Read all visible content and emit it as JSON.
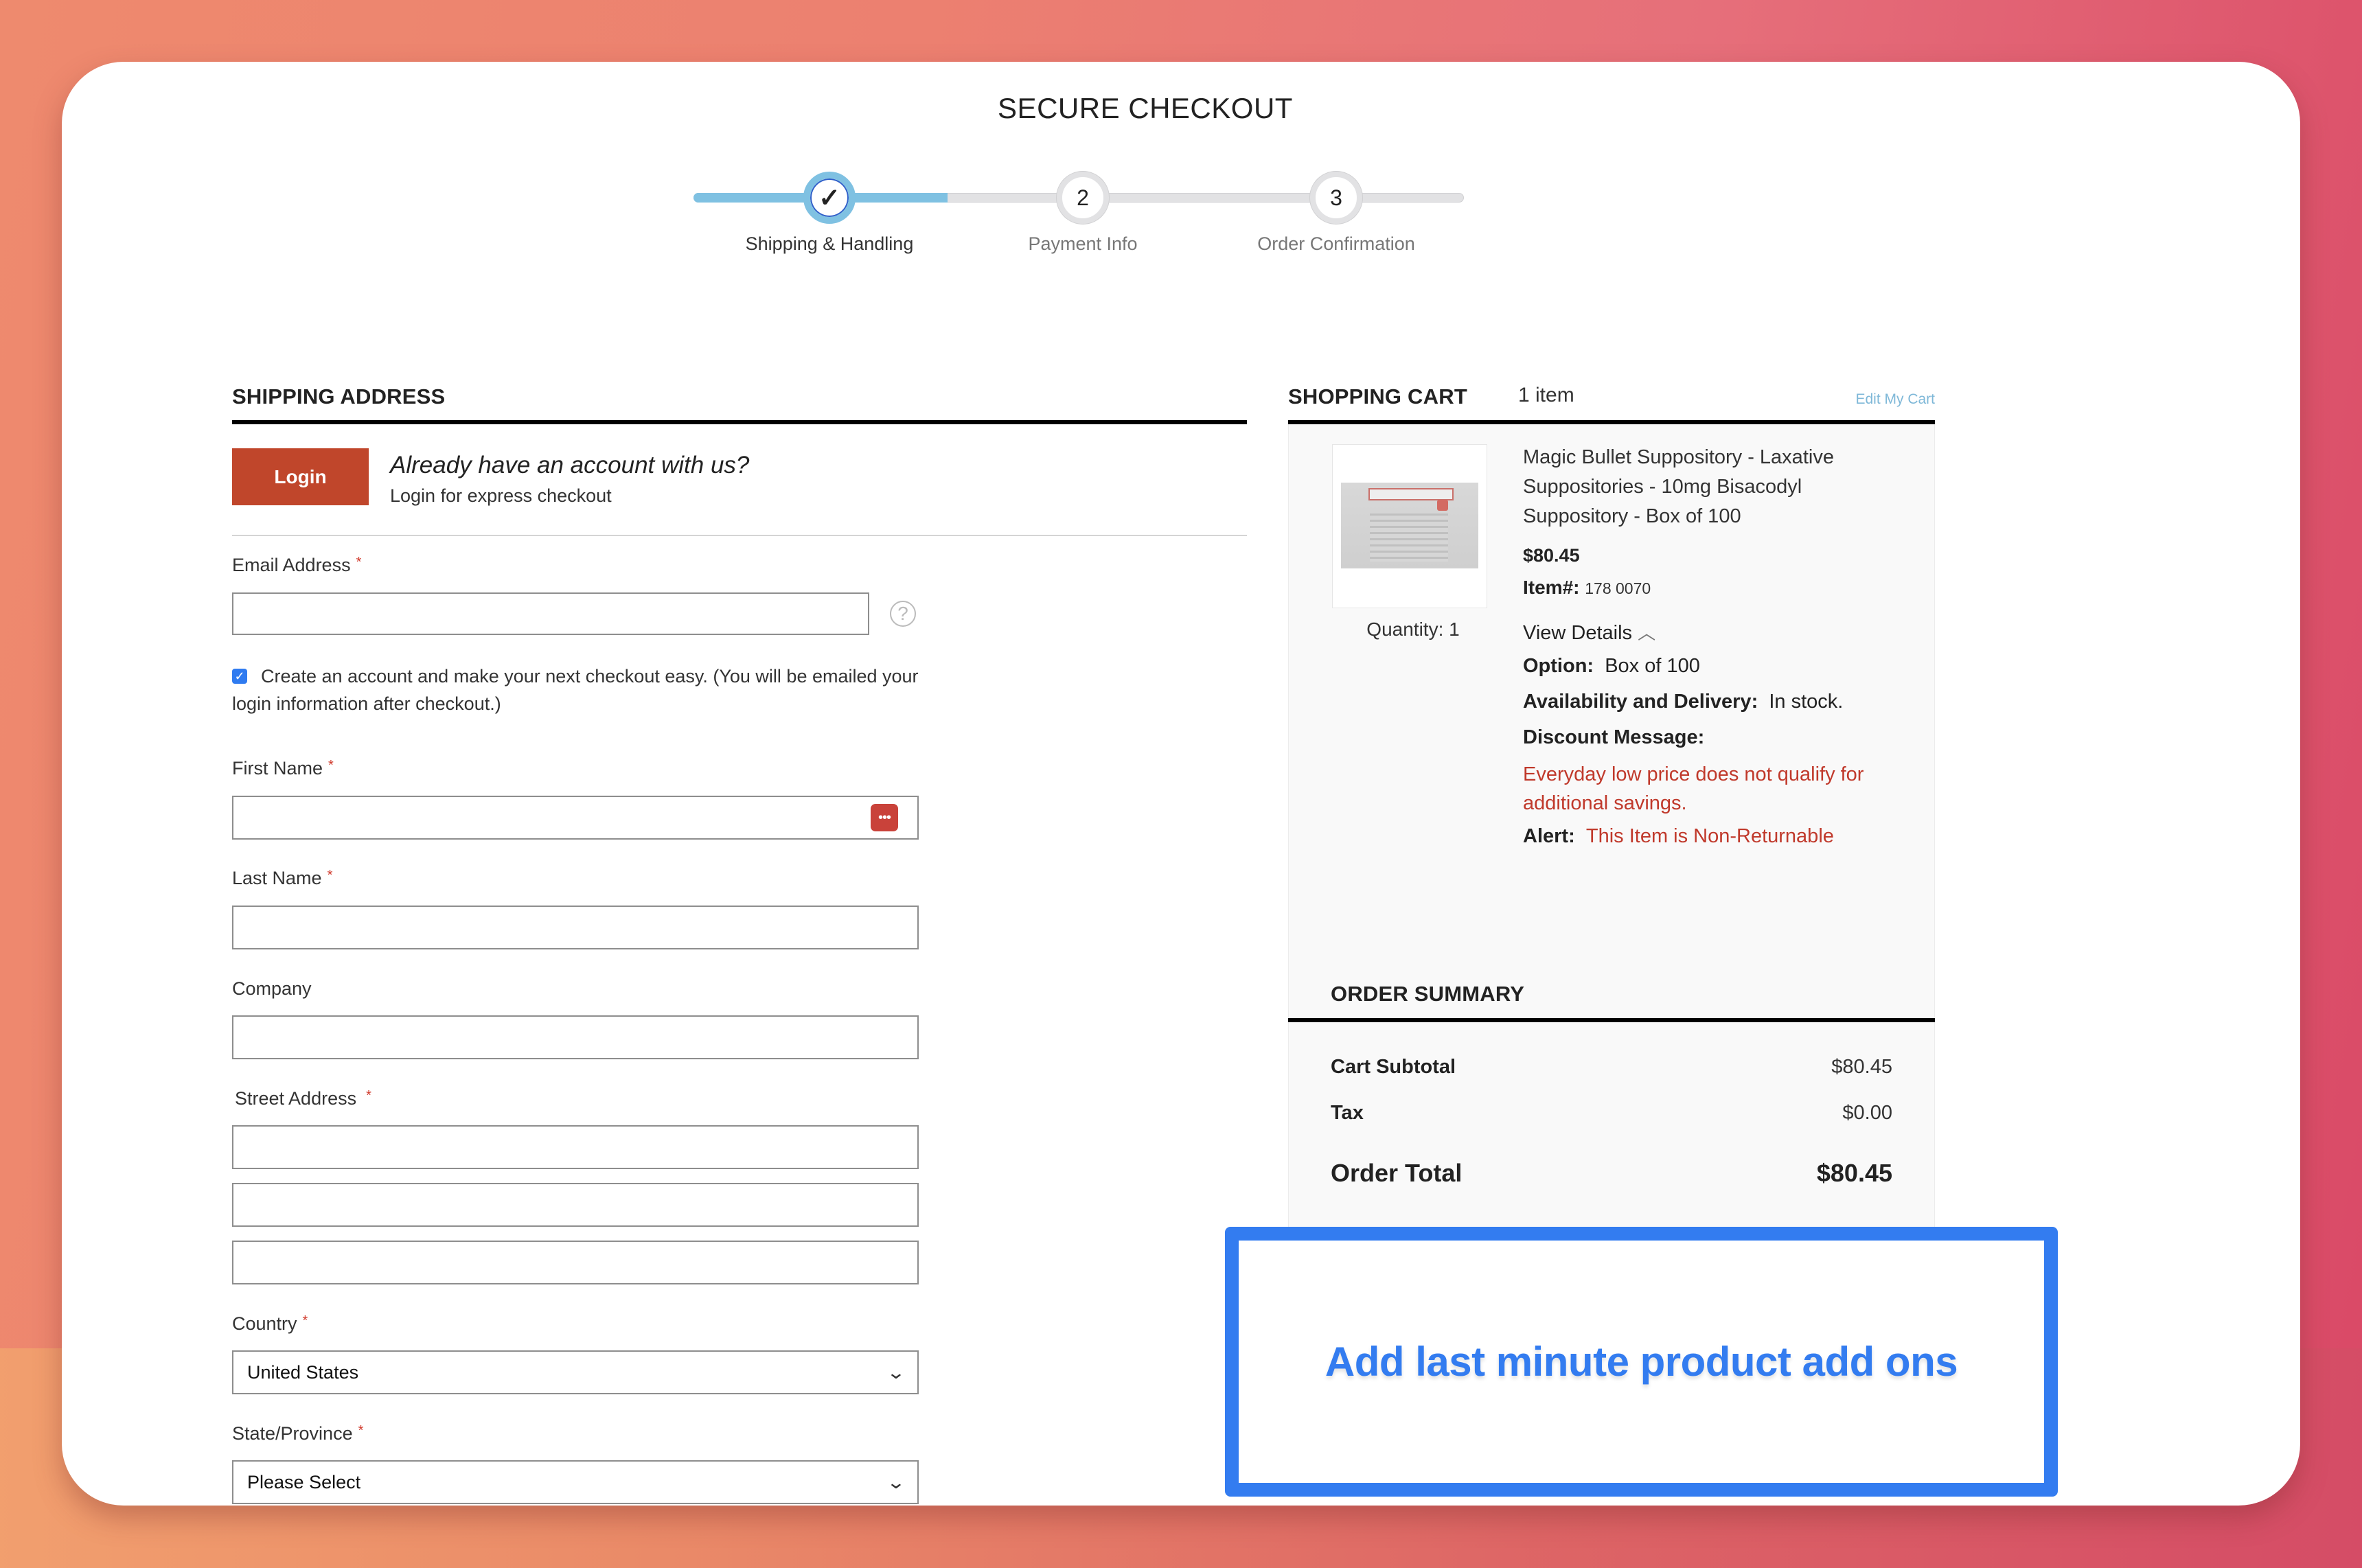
{
  "page": {
    "title": "SECURE CHECKOUT"
  },
  "stepper": {
    "progress_percent": 33,
    "steps": [
      {
        "number": "✓",
        "label": "Shipping & Handling",
        "state": "done"
      },
      {
        "number": "2",
        "label": "Payment Info",
        "state": "todo"
      },
      {
        "number": "3",
        "label": "Order Confirmation",
        "state": "todo"
      }
    ]
  },
  "shipping": {
    "heading": "SHIPPING ADDRESS",
    "login_button": "Login",
    "account_question": "Already have an account with us?",
    "account_sub": "Login for express checkout",
    "required_mark": "*",
    "email": {
      "label": "Email Address",
      "value": "",
      "help_icon": "?"
    },
    "create_account": {
      "checked": true,
      "text": "Create an account and make your next checkout easy. (You will be emailed your login information after checkout.)"
    },
    "first_name": {
      "label": "First Name",
      "value": "",
      "autofill_icon": "•••"
    },
    "last_name": {
      "label": "Last Name",
      "value": ""
    },
    "company": {
      "label": "Company",
      "value": ""
    },
    "street": {
      "label": "Street Address",
      "line1": "",
      "line2": "",
      "line3": ""
    },
    "country": {
      "label": "Country",
      "selected": "United States"
    },
    "state": {
      "label": "State/Province",
      "selected": "Please Select"
    }
  },
  "cart": {
    "heading": "SHOPPING CART",
    "count": "1 item",
    "edit_link": "Edit My Cart",
    "item": {
      "name": "Magic Bullet Suppository - Laxative Suppositories - 10mg Bisacodyl Suppository - Box of 100",
      "price": "$80.45",
      "item_no_label": "Item#:",
      "item_no": "178 0070",
      "quantity": "Quantity: 1",
      "view_details": "View Details",
      "option_label": "Option:",
      "option_value": "Box of 100",
      "availability_label": "Availability and Delivery:",
      "availability_value": "In stock.",
      "discount_label": "Discount Message:",
      "discount_message": "Everyday low price does not qualify for additional savings.",
      "alert_label": "Alert:",
      "alert_message": "This Item is Non-Returnable"
    }
  },
  "summary": {
    "heading": "ORDER SUMMARY",
    "subtotal_label": "Cart Subtotal",
    "subtotal_value": "$80.45",
    "tax_label": "Tax",
    "tax_value": "$0.00",
    "total_label": "Order Total",
    "total_value": "$80.45"
  },
  "callout": {
    "text": "Add last minute product add ons",
    "color": "#337cf0"
  },
  "colors": {
    "login_button": "#c0462b",
    "stepper_active": "#7fc1e2",
    "alert_red": "#c0392b",
    "edit_link": "#7fb8d8"
  }
}
